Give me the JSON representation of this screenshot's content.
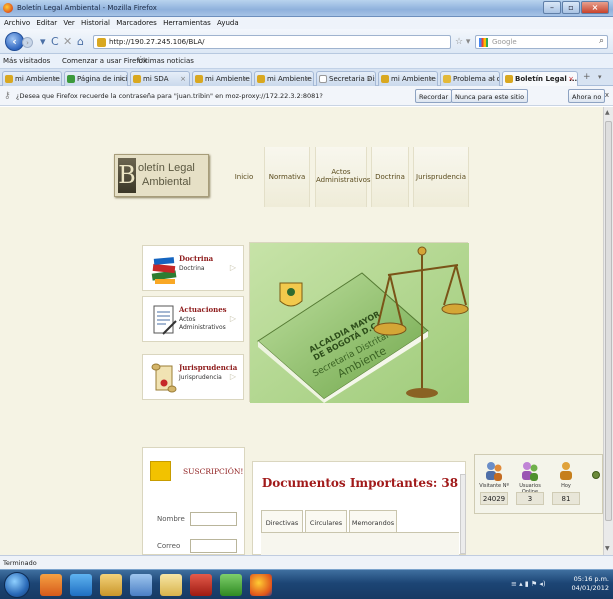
{
  "window": {
    "title": "Boletín Legal Ambiental - Mozilla Firefox"
  },
  "menu": [
    "Archivo",
    "Editar",
    "Ver",
    "Historial",
    "Marcadores",
    "Herramientas",
    "Ayuda"
  ],
  "nav": {
    "back_icon": "back-arrow-icon",
    "forward_icon": "forward-arrow-icon",
    "reload_icon": "reload-icon",
    "stop_icon": "stop-icon",
    "home_icon": "home-icon",
    "url": "http://190.27.245.106/BLA/",
    "search_placeholder": "Google"
  },
  "bookmarks": [
    "Más visitados",
    "Comenzar a usar Firefox",
    "Últimas noticias"
  ],
  "tabs": [
    {
      "label": "mi Ambiente"
    },
    {
      "label": "Página de inicio..."
    },
    {
      "label": "mi SDA"
    },
    {
      "label": "mi Ambiente"
    },
    {
      "label": "mi Ambiente"
    },
    {
      "label": "Secretaria Distri..."
    },
    {
      "label": "mi Ambiente"
    },
    {
      "label": "Problema al car..."
    },
    {
      "label": "Boletín Legal ...",
      "active": true
    }
  ],
  "notification": {
    "message": "¿Desea que Firefox recuerde la contraseña para \"juan.tribin\" en moz-proxy://172.22.3.2:8081?",
    "remember": "Recordar",
    "never": "Nunca para este sitio",
    "not_now": "Ahora no",
    "close": "x"
  },
  "site": {
    "logo_line1": "oletín Legal",
    "logo_line2": "Ambiental",
    "logo_letter": "B",
    "nav": [
      "Inicio",
      "Normativa",
      "Actos Administrativos",
      "Doctrina",
      "Jurisprudencia"
    ]
  },
  "categories": [
    {
      "title": "Doctrina",
      "line1": "Doctrina",
      "line2": ""
    },
    {
      "title": "Actuaciones",
      "line1": "Actos",
      "line2": "Administrativos"
    },
    {
      "title": "Jurisprudencia",
      "line1": "Jurisprudencia",
      "line2": ""
    }
  ],
  "hero": {
    "seal_line1": "ALCALDIA MAYOR",
    "seal_line2": "DE BOGOTÁ D.C.",
    "seal_line3": "Secretaria Distrital",
    "seal_line4": "Ambiente"
  },
  "subscription": {
    "title": "SUSCRIPCIÓN!",
    "name_label": "Nombre",
    "email_label": "Correo"
  },
  "documents": {
    "title": "Documentos Importantes: 38",
    "tabs": [
      "Directivas",
      "Circulares",
      "Memorandos"
    ]
  },
  "stats": {
    "visitors_label": "Visitante Nº",
    "visitors": "24029",
    "online_label": "Usuarios Online",
    "online": "3",
    "today_label": "Hoy",
    "today": "81"
  },
  "status": "Terminado",
  "clock": {
    "time": "05:16 p.m.",
    "date": "04/01/2012"
  },
  "colors": {
    "page_bg": "#f5f3e4",
    "accent_red": "#a11a1a",
    "nav_brown": "#5a4b1d",
    "taskbar": "#1c4575"
  }
}
